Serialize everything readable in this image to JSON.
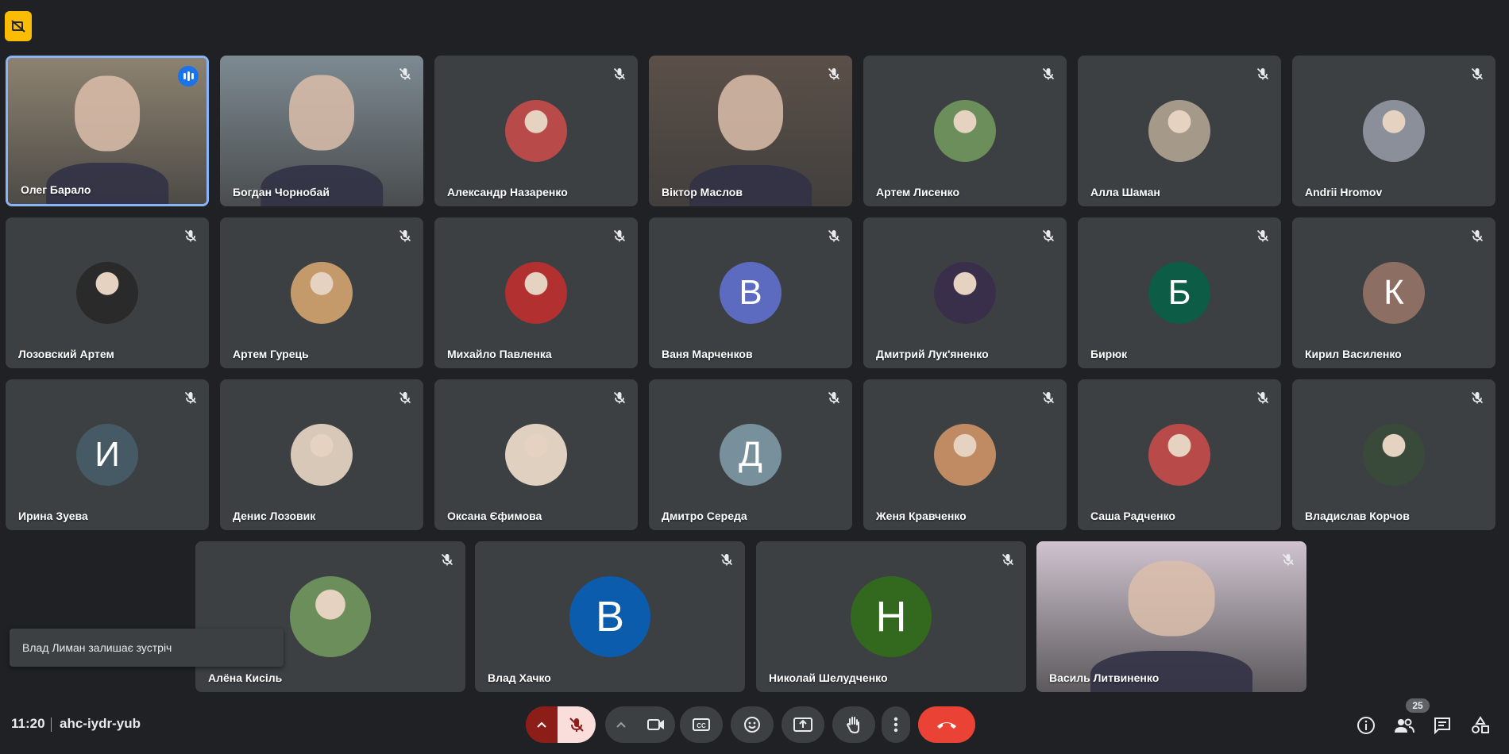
{
  "meeting": {
    "time": "11:20",
    "code": "ahc-iydr-yub",
    "participant_count": "25",
    "toast": "Влад Лиман залишає зустріч"
  },
  "participants": [
    {
      "name": "Олег Барало",
      "type": "video",
      "speaking": true
    },
    {
      "name": "Богдан Чорнобай",
      "type": "video",
      "muted": true
    },
    {
      "name": "Александр Назаренко",
      "type": "photo",
      "muted": true
    },
    {
      "name": "Віктор Маслов",
      "type": "video",
      "muted": true
    },
    {
      "name": "Артем Лисенко",
      "type": "photo",
      "muted": true
    },
    {
      "name": "Алла Шаман",
      "type": "photo",
      "muted": true
    },
    {
      "name": "Andrii Hromov",
      "type": "photo",
      "muted": true
    },
    {
      "name": "Лозовский Артем",
      "type": "photo",
      "muted": true
    },
    {
      "name": "Артем Гурець",
      "type": "photo",
      "muted": true
    },
    {
      "name": "Михайло Павленка",
      "type": "photo",
      "muted": true
    },
    {
      "name": "Ваня Марченков",
      "type": "initial",
      "initial": "В",
      "color": "#5c6bc0",
      "muted": true
    },
    {
      "name": "Дмитрий Лук'яненко",
      "type": "photo",
      "muted": true
    },
    {
      "name": "Бирюк",
      "type": "initial",
      "initial": "Б",
      "color": "#0d5c46",
      "muted": true
    },
    {
      "name": "Кирил Василенко",
      "type": "initial",
      "initial": "К",
      "color": "#8d6e63",
      "muted": true
    },
    {
      "name": "Ирина Зуева",
      "type": "initial",
      "initial": "И",
      "color": "#455a64",
      "muted": true
    },
    {
      "name": "Денис Лозовик",
      "type": "photo",
      "muted": true
    },
    {
      "name": "Оксана Єфимова",
      "type": "photo",
      "muted": true
    },
    {
      "name": "Дмитро Середа",
      "type": "initial",
      "initial": "Д",
      "color": "#78909c",
      "muted": true
    },
    {
      "name": "Женя Кравченко",
      "type": "photo",
      "muted": true
    },
    {
      "name": "Саша Радченко",
      "type": "photo",
      "muted": true
    },
    {
      "name": "Владислав Корчов",
      "type": "photo",
      "muted": true
    },
    {
      "name": "Алёна Кисіль",
      "type": "photo",
      "muted": true
    },
    {
      "name": "Влад Хачко",
      "type": "initial",
      "initial": "В",
      "color": "#0b5cad",
      "muted": true
    },
    {
      "name": "Николай Шелудченко",
      "type": "initial",
      "initial": "Н",
      "color": "#33691e",
      "muted": true
    },
    {
      "name": "Василь Литвиненко",
      "type": "video",
      "muted": true
    }
  ],
  "colors": {
    "background": "#202124",
    "tile": "#3c4043",
    "active_border": "#8ab4f8",
    "end_call": "#ea4335",
    "mic_muted_bg": "#f9dedc",
    "badge": "#fbbc04"
  },
  "icons": [
    "no-recording-icon",
    "mic-off-icon",
    "chevron-up-icon",
    "camera-icon",
    "captions-icon",
    "emoji-icon",
    "present-icon",
    "raise-hand-icon",
    "more-icon",
    "end-call-icon",
    "info-icon",
    "people-icon",
    "chat-icon",
    "activities-icon"
  ]
}
